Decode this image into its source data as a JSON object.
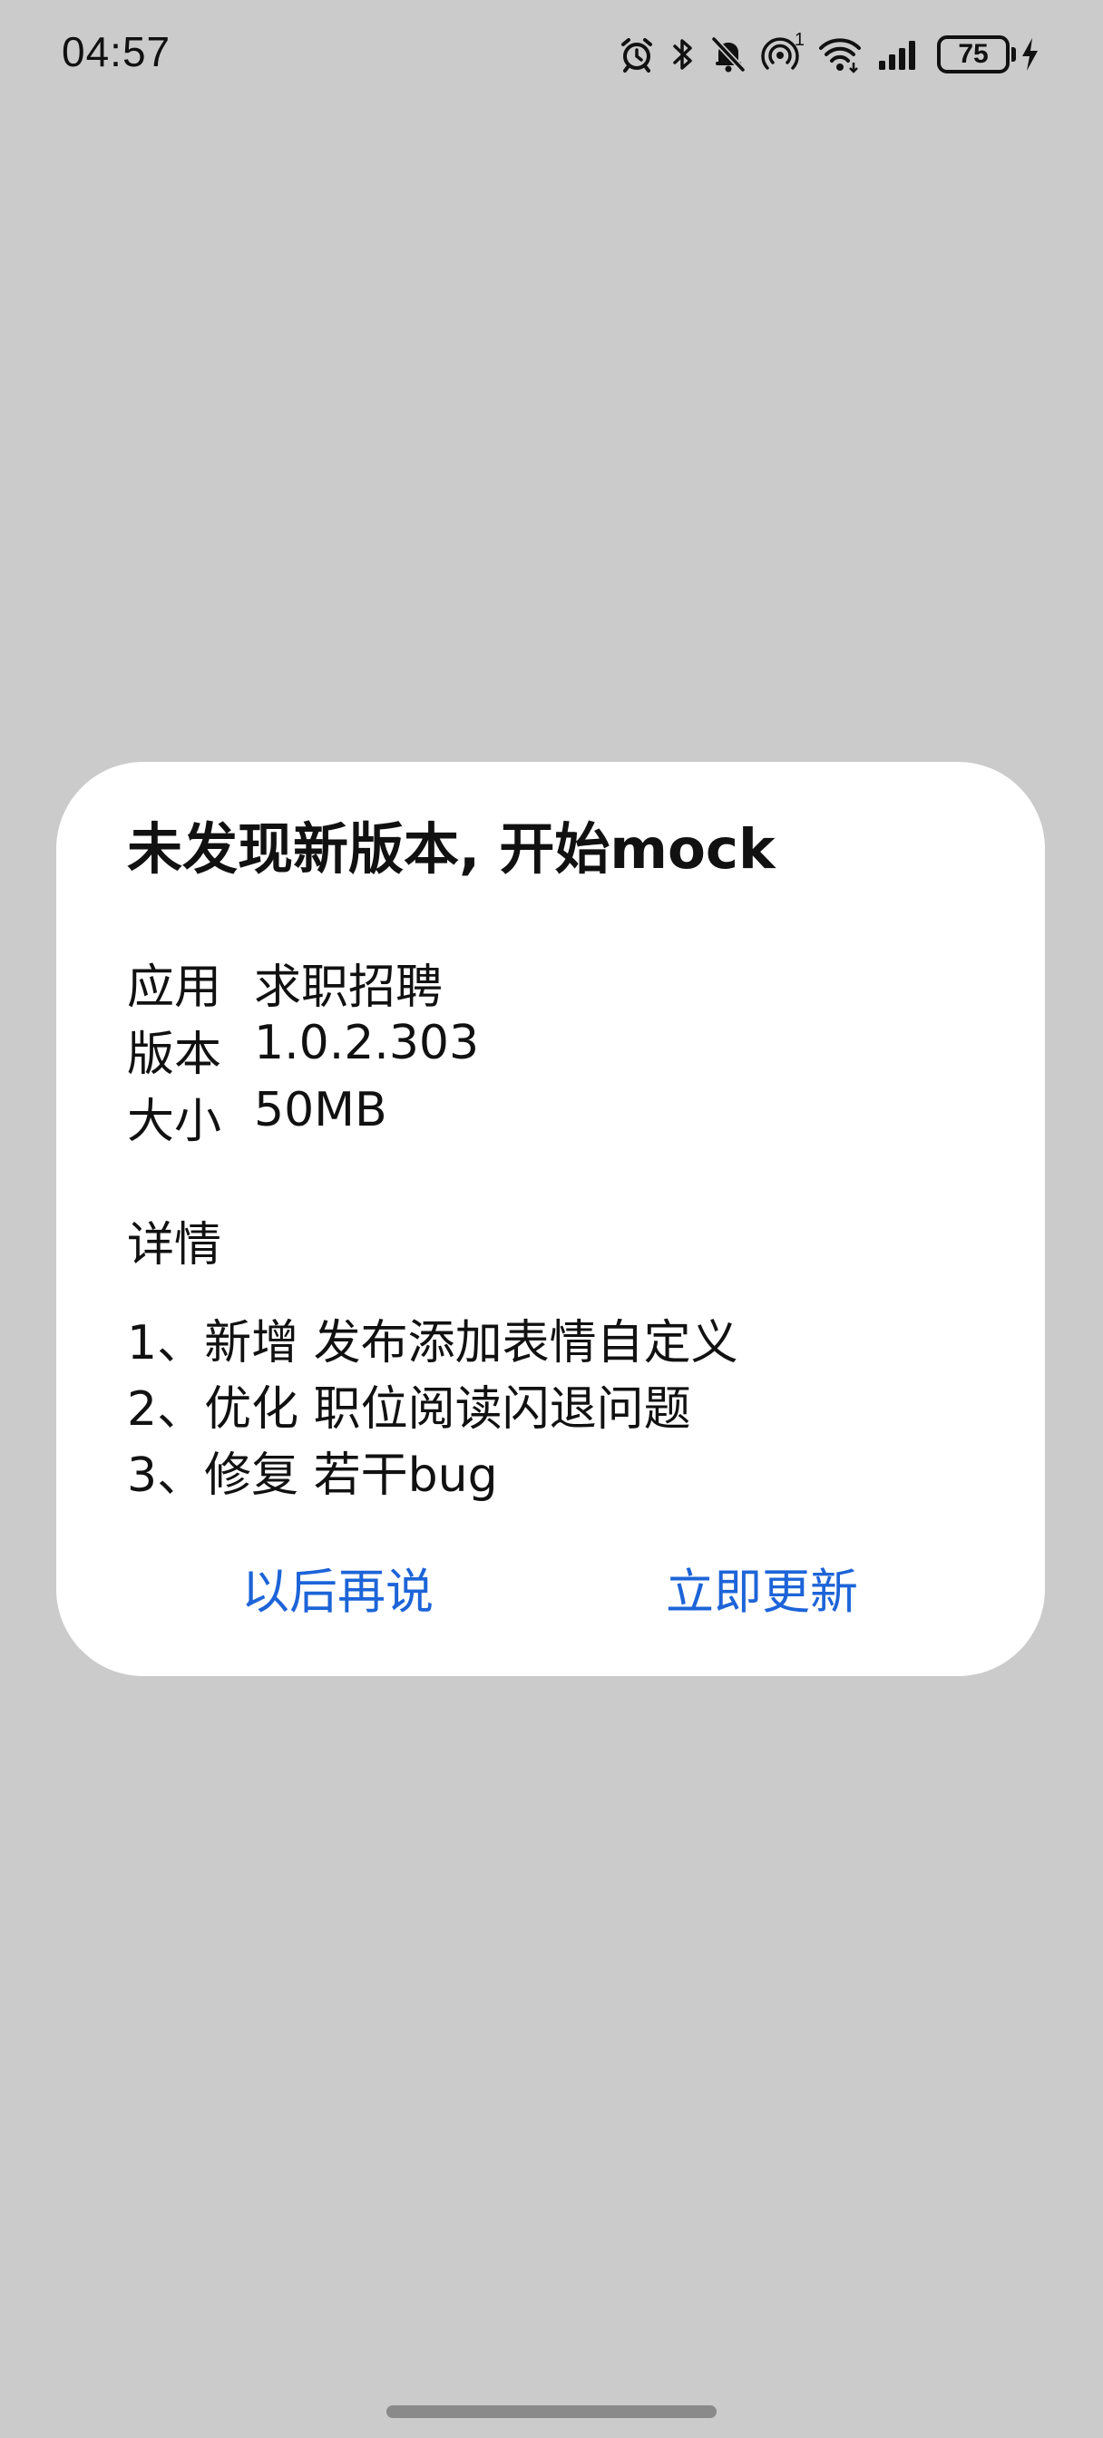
{
  "status_bar": {
    "time": "04:57",
    "icons": [
      "alarm-icon",
      "bluetooth-icon",
      "notifications-off-icon",
      "hotspot-icon",
      "wifi-icon",
      "signal-icon"
    ],
    "hotspot_badge": "1",
    "battery_level": "75",
    "charging": true
  },
  "dialog": {
    "title": "未发现新版本, 开始mock",
    "info": [
      {
        "key": "应用",
        "value": "求职招聘"
      },
      {
        "key": "版本",
        "value": "1.0.2.303"
      },
      {
        "key": "大小",
        "value": "50MB"
      }
    ],
    "details_title": "详情",
    "details": [
      "1、新增 发布添加表情自定义",
      "2、优化 职位阅读闪退问题",
      "3、修复 若干bug"
    ],
    "later_button": "以后再说",
    "update_button": "立即更新",
    "accent_color": "#1d64d8"
  }
}
